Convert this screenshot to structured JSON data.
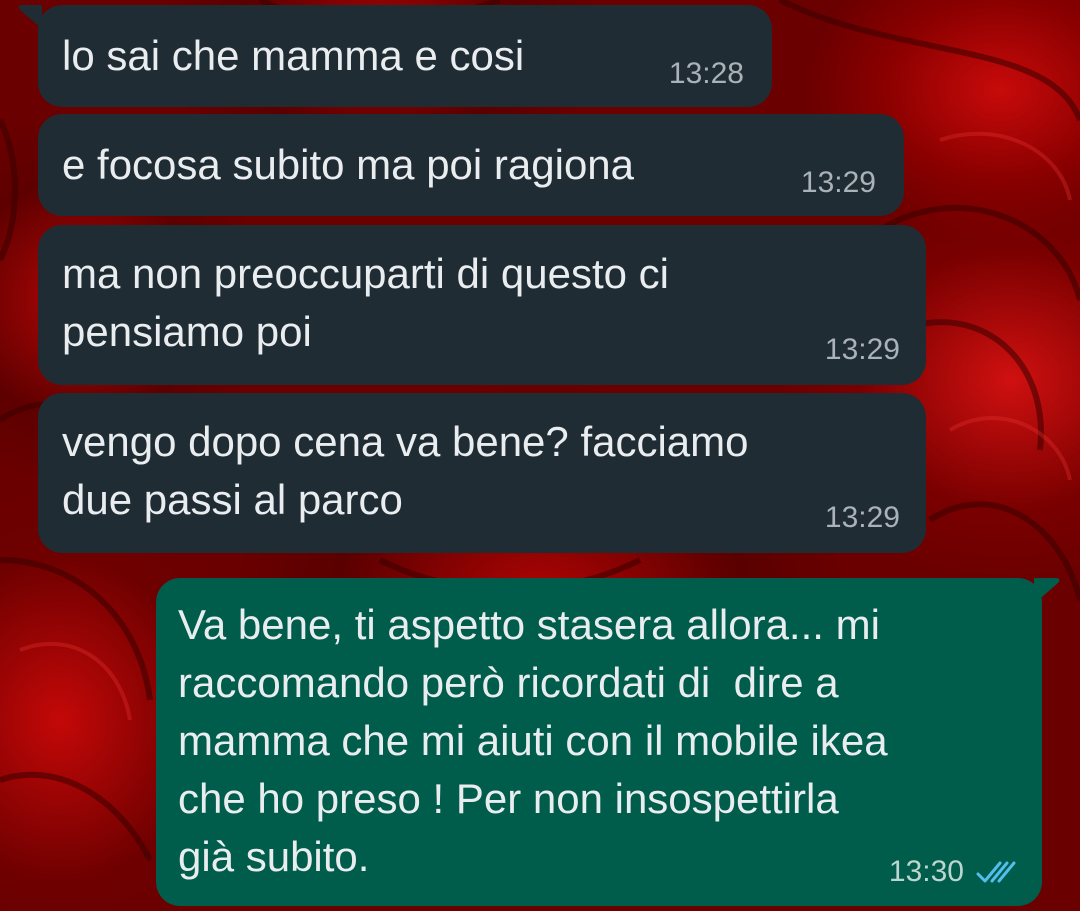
{
  "messages": [
    {
      "direction": "incoming",
      "lines": [
        "lo sai che mamma e cosi"
      ],
      "time": "13:28"
    },
    {
      "direction": "incoming",
      "lines": [
        "e focosa subito ma poi ragiona"
      ],
      "time": "13:29"
    },
    {
      "direction": "incoming",
      "lines": [
        "ma non preoccuparti di questo ci",
        "pensiamo poi"
      ],
      "time": "13:29"
    },
    {
      "direction": "incoming",
      "lines": [
        "vengo dopo cena va bene? facciamo",
        "due passi al parco"
      ],
      "time": "13:29"
    },
    {
      "direction": "outgoing",
      "lines": [
        "Va bene, ti aspetto stasera allora... mi",
        "raccomando però ricordati di  dire a",
        "mamma che mi aiuti con il mobile ikea",
        "che ho preso ! Per non insospettirla",
        "già subito."
      ],
      "time": "13:30",
      "status": "read",
      "status_icon": "double-check-icon"
    }
  ],
  "colors": {
    "incoming_bubble": "#202c33",
    "outgoing_bubble": "#005c4b",
    "text": "#e9edef",
    "read_ticks": "#53bdeb",
    "wallpaper": "#8a0000"
  }
}
